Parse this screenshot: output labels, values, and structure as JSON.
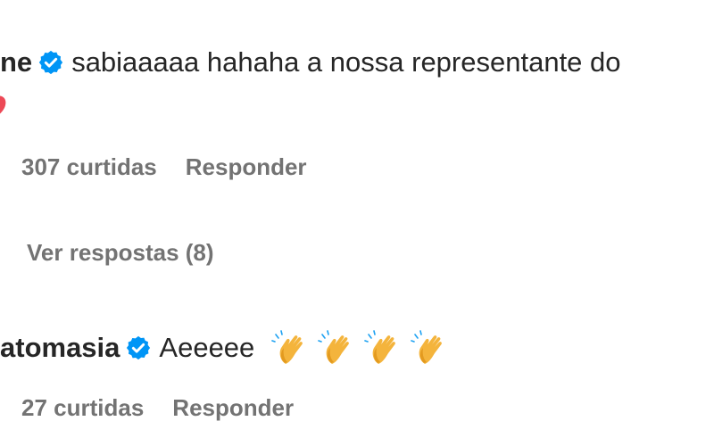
{
  "comments": [
    {
      "username": "ne",
      "verified": true,
      "text": "sabiaaaaa hahaha a nossa representante do",
      "trailing_icon": "heart-icon",
      "likes": "307 curtidas",
      "reply_label": "Responder",
      "view_replies": "Ver respostas (8)"
    },
    {
      "username": "atomasia",
      "verified": true,
      "text": "Aeeeee",
      "emojis": [
        "clapping-hands-icon",
        "clapping-hands-icon",
        "clapping-hands-icon",
        "clapping-hands-icon"
      ],
      "likes": "27 curtidas",
      "reply_label": "Responder"
    }
  ],
  "colors": {
    "text": "#262626",
    "meta": "#737373",
    "verified": "#0095F6",
    "heart": "#ED4956",
    "clap": "#F4B43C"
  }
}
